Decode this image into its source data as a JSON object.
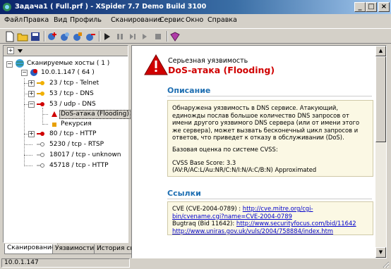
{
  "window": {
    "title": "Задача1 ( Full.prf ) - XSpider 7.7 Demo Build 3100"
  },
  "menu": [
    "Файл",
    "Правка",
    "Вид",
    "Профиль",
    "Сканирование",
    "Сервис",
    "Окно",
    "Справка"
  ],
  "tree": {
    "root": "Сканируемые хосты ( 1 )",
    "host": "10.0.1.147 ( 64 )",
    "services": [
      {
        "label": "23 / tcp - Telnet"
      },
      {
        "label": "53 / tcp - DNS"
      },
      {
        "label": "53 / udp - DNS"
      },
      {
        "label": "DoS-атака (Flooding)"
      },
      {
        "label": "Рекурсия"
      },
      {
        "label": "80 / tcp - HTTP"
      },
      {
        "label": "5230 / tcp - RTSP"
      },
      {
        "label": "18017 / tcp - unknown"
      },
      {
        "label": "45718 / tcp - HTTP"
      }
    ]
  },
  "tabs": [
    "Сканирование",
    "Уязвимости",
    "История сканирований"
  ],
  "content": {
    "severity": "Серьезная уязвимость",
    "vuln_title": "DoS-атака (Flooding)",
    "description_heading": "Описание",
    "description_lines": [
      "Обнаружена уязвимость в DNS сервисе. Атакующий,",
      "единожды послав большое количество DNS запросов от",
      "имени другого уязвимого DNS сервера (или от имени этого",
      "же сервера), может вызвать бесконечный цикл запросов и",
      "ответов, что приведет к отказу в обслуживании (DoS)."
    ],
    "cvss_label": "Базовая оценка по системе CVSS:",
    "cvss_score": "CVSS Base Score: 3.3",
    "cvss_vector": "(AV:R/AC:L/Au:NR/C:N/I:N/A:C/B:N) Approximated",
    "links_heading": "Ссылки",
    "link1_prefix": "CVE (CVE-2004-0789) : ",
    "link1_url_a": "http://cve.mitre.org/cgi-",
    "link1_url_b": "bin/cvename.cgi?name=CVE-2004-0789",
    "link2_prefix": "Bugtraq (Bid 11642): ",
    "link2_url": "http://www.securityfocus.com/bid/11642",
    "link3_url": "http://www.uniras.gov.uk/vuls/2004/758884/index.htm"
  },
  "status": {
    "ip": "10.0.1.147"
  },
  "colors": {
    "accent": "#1f6fb2",
    "danger": "#d00000",
    "title_bg": "#0a246a"
  }
}
